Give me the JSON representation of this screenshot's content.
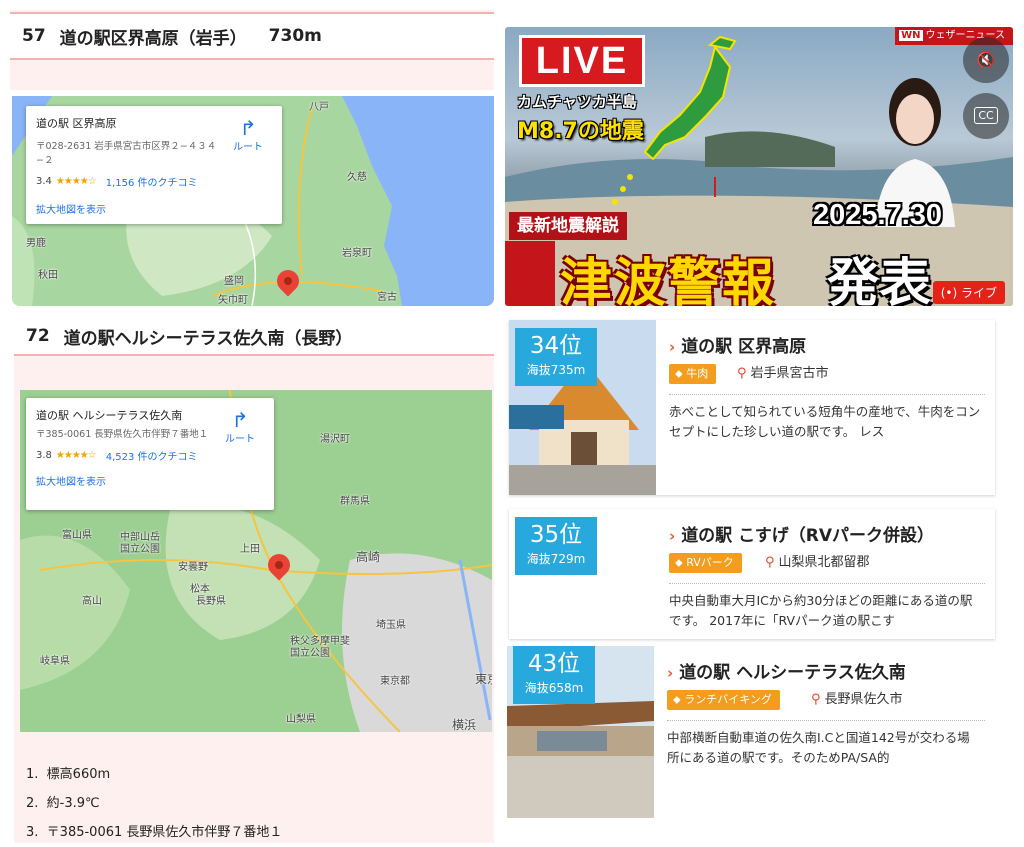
{
  "left": {
    "section57": {
      "num": "57",
      "title": "道の駅区界高原（岩手）",
      "elevation": "730m"
    },
    "map1": {
      "name": "道の駅 区界高原",
      "address": "〒028-2631 岩手県宮古市区界２−４３４−２",
      "rating": "3.4",
      "stars": "★★★★☆",
      "reviews": "1,156 件のクチコミ",
      "larger_map": "拡大地図を表示",
      "route": "ルート",
      "labels": {
        "hachinohe": "八戸",
        "kuji": "久慈",
        "iwaizumi": "岩泉町",
        "morioka": "盛岡",
        "miyako": "宮古",
        "akita": "秋田",
        "oga": "男鹿",
        "yahaba": "矢巾町"
      }
    },
    "section72": {
      "num": "72",
      "title": "道の駅ヘルシーテラス佐久南（長野）"
    },
    "map2": {
      "name": "道の駅 ヘルシーテラス佐久南",
      "address": "〒385-0061 長野県佐久市伴野７番地１",
      "rating": "3.8",
      "stars": "★★★★☆",
      "reviews": "4,523 件のクチコミ",
      "larger_map": "拡大地図を表示",
      "route": "ルート",
      "labels": {
        "yuzawa": "湯沢町",
        "gunma": "群馬県",
        "takasaki": "高崎",
        "toyama": "富山県",
        "takayama": "高山",
        "chubu": "中部山岳\n国立公園",
        "azumino": "安曇野",
        "matsumoto": "松本",
        "ueda": "上田",
        "nagano": "長野県",
        "saitama": "埼玉県",
        "gifu": "岐阜県",
        "chichibu": "秩父多摩甲斐\n国立公園",
        "tokyo": "東京都",
        "yamanashi": "山梨県",
        "yokohama": "横浜",
        "higashi": "東京"
      }
    },
    "list": [
      {
        "n": "1.",
        "text": "標高660m"
      },
      {
        "n": "2.",
        "text": "約-3.9℃"
      },
      {
        "n": "3.",
        "text": "〒385-0061 長野県佐久市伴野７番地１"
      }
    ]
  },
  "video": {
    "live": "LIVE",
    "line1": "カムチャツカ半島",
    "line2": "M8.7の地震",
    "date": "2025.7.30",
    "tag": "最新地震解説",
    "headline_a": "津波警報",
    "headline_b": "発表",
    "channel": "ウェザーニュース",
    "channel_logo": "WN",
    "live_badge": "(•) ライブ",
    "mute_icon": "🔇",
    "cc": "CC"
  },
  "cards": [
    {
      "rank": "34位",
      "elev": "海抜735m",
      "name": "道の駅 区界高原",
      "tag": "牛肉",
      "location": "岩手県宮古市",
      "desc": "赤べことして知られている短角牛の産地で、牛肉をコンセプトにした珍しい道の駅です。 レス"
    },
    {
      "rank": "35位",
      "elev": "海抜729m",
      "name": "道の駅 こすげ（RVパーク併設）",
      "tag": "RVパーク",
      "location": "山梨県北都留郡",
      "desc": "中央自動車大月ICから約30分ほどの距離にある道の駅です。 2017年に「RVパーク道の駅こす"
    },
    {
      "rank": "43位",
      "elev": "海抜658m",
      "name": "道の駅 ヘルシーテラス佐久南",
      "tag": "ランチバイキング",
      "location": "長野県佐久市",
      "desc": "中部横断自動車道の佐久南I.Cと国道142号が交わる場所にある道の駅です。そのためPA/SA的"
    }
  ]
}
